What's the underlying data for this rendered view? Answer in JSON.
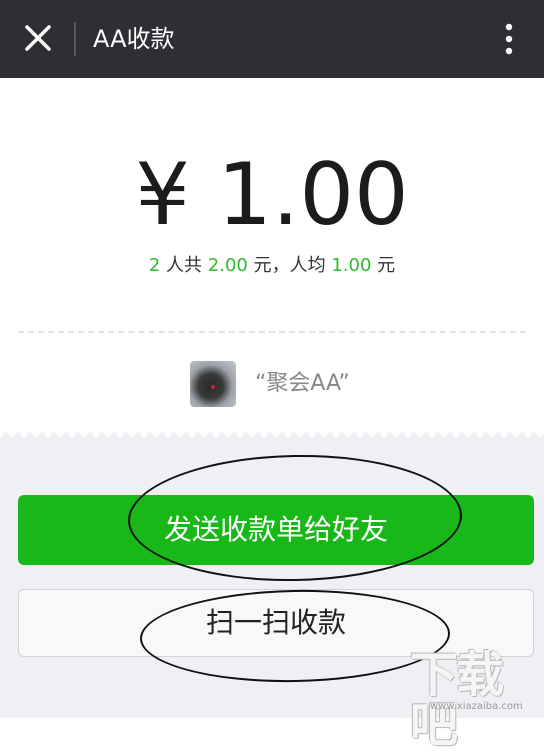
{
  "header": {
    "title": "AA收款",
    "close_icon": "close-icon",
    "menu_icon": "more-vertical-icon",
    "background": "#2d2f33"
  },
  "summary": {
    "amount": "¥ 1.00",
    "people_count": "2",
    "people_label": " 人共 ",
    "total": "2.00",
    "total_label": " 元，人均 ",
    "per_person": "1.00",
    "per_person_label": " 元",
    "highlight_color": "#2dbb2d"
  },
  "group": {
    "name": "“聚会AA”"
  },
  "actions": {
    "send_label": "发送收款单给好友",
    "scan_label": "扫一扫收款",
    "send_color": "#18b818"
  },
  "watermark": {
    "logo": "下载吧",
    "url": "www.xiazaiba.com"
  }
}
